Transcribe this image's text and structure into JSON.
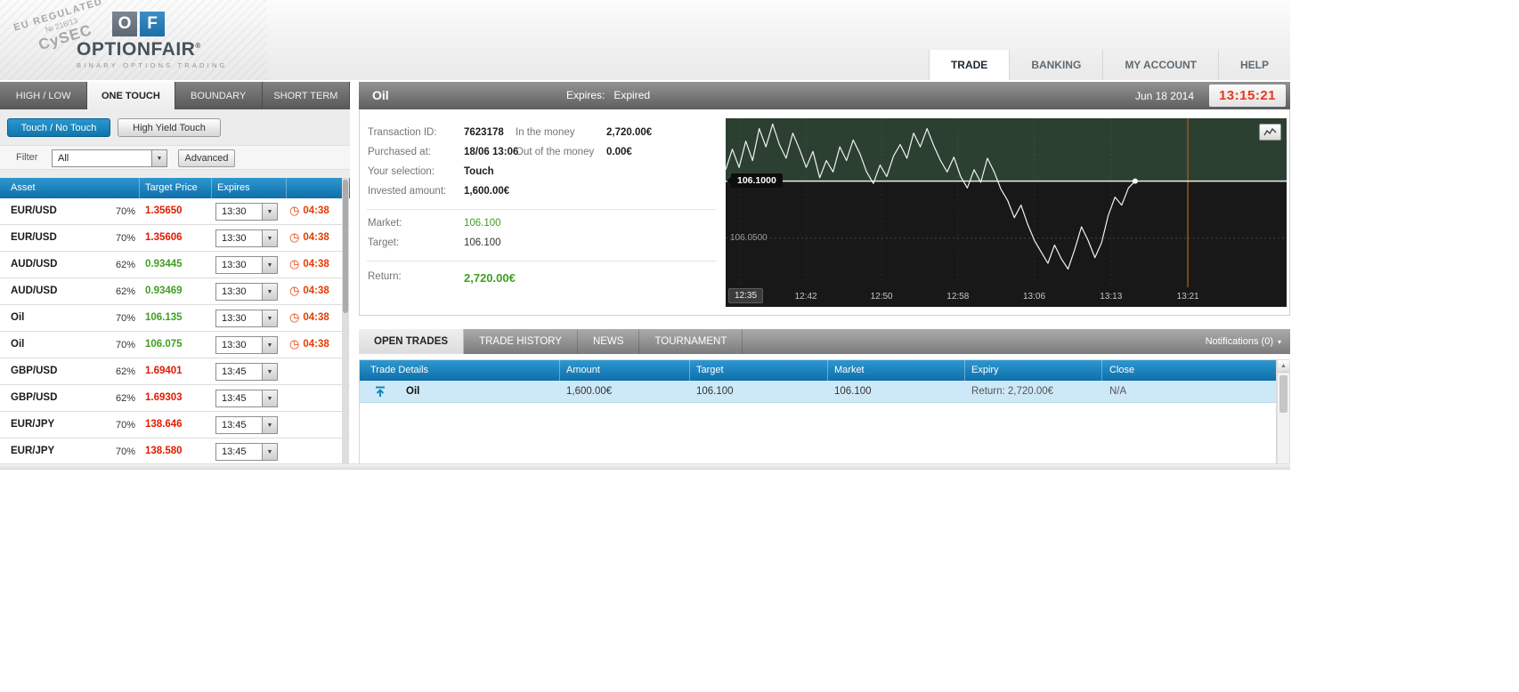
{
  "header": {
    "stamp": {
      "line1": "EU REGULATED",
      "line2": "№ 216/13",
      "line3": "CySEC"
    },
    "logo": {
      "icon_o": "O",
      "icon_f": "F",
      "name": "OPTIONFAIR",
      "reg": "®",
      "tagline": "BINARY OPTIONS TRADING"
    },
    "nav": [
      {
        "label": "TRADE",
        "active": true
      },
      {
        "label": "BANKING",
        "active": false
      },
      {
        "label": "MY ACCOUNT",
        "active": false
      },
      {
        "label": "HELP",
        "active": false
      }
    ]
  },
  "instrument_tabs": [
    {
      "label": "HIGH / LOW",
      "active": false
    },
    {
      "label": "ONE TOUCH",
      "active": true
    },
    {
      "label": "BOUNDARY",
      "active": false
    },
    {
      "label": "SHORT TERM",
      "active": false
    }
  ],
  "left_panel": {
    "touch_button": "Touch / No Touch",
    "high_yield_button": "High Yield Touch",
    "filter_label": "Filter",
    "filter_value": "All",
    "advanced_button": "Advanced",
    "table_headers": [
      "Asset",
      "Target Price",
      "Expires"
    ],
    "rows": [
      {
        "asset": "EUR/USD",
        "payout": "70%",
        "price": "1.35650",
        "trend": "red",
        "expiry": "13:30",
        "countdown": "04:38"
      },
      {
        "asset": "EUR/USD",
        "payout": "70%",
        "price": "1.35606",
        "trend": "red",
        "expiry": "13:30",
        "countdown": "04:38"
      },
      {
        "asset": "AUD/USD",
        "payout": "62%",
        "price": "0.93445",
        "trend": "green",
        "expiry": "13:30",
        "countdown": "04:38"
      },
      {
        "asset": "AUD/USD",
        "payout": "62%",
        "price": "0.93469",
        "trend": "green",
        "expiry": "13:30",
        "countdown": "04:38"
      },
      {
        "asset": "Oil",
        "payout": "70%",
        "price": "106.135",
        "trend": "green",
        "expiry": "13:30",
        "countdown": "04:38"
      },
      {
        "asset": "Oil",
        "payout": "70%",
        "price": "106.075",
        "trend": "green",
        "expiry": "13:30",
        "countdown": "04:38"
      },
      {
        "asset": "GBP/USD",
        "payout": "62%",
        "price": "1.69401",
        "trend": "red",
        "expiry": "13:45",
        "countdown": ""
      },
      {
        "asset": "GBP/USD",
        "payout": "62%",
        "price": "1.69303",
        "trend": "red",
        "expiry": "13:45",
        "countdown": ""
      },
      {
        "asset": "EUR/JPY",
        "payout": "70%",
        "price": "138.646",
        "trend": "red",
        "expiry": "13:45",
        "countdown": ""
      },
      {
        "asset": "EUR/JPY",
        "payout": "70%",
        "price": "138.580",
        "trend": "red",
        "expiry": "13:45",
        "countdown": ""
      }
    ]
  },
  "trade_panel": {
    "title": "Oil",
    "expires_label": "Expires:",
    "expires_value": "Expired",
    "date": "Jun 18 2014",
    "time": "13:15:21",
    "transaction_id_label": "Transaction ID:",
    "transaction_id": "7623178",
    "purchased_label": "Purchased at:",
    "purchased": "18/06 13:06",
    "selection_label": "Your selection:",
    "selection": "Touch",
    "invested_label": "Invested amount:",
    "invested": "1,600.00€",
    "in_money_label": "In the money",
    "in_money": "2,720.00€",
    "out_money_label": "Out of the money",
    "out_money": "0.00€",
    "market_label": "Market:",
    "market": "106.100",
    "target_label": "Target:",
    "target": "106.100",
    "return_label": "Return:",
    "return_value": "2,720.00€"
  },
  "chart_data": {
    "type": "line",
    "title": "Oil intraday price",
    "x_ticks": [
      "12:35",
      "12:42",
      "12:50",
      "12:58",
      "13:06",
      "13:13",
      "13:21"
    ],
    "x_tick_fractions": [
      0.025,
      0.143,
      0.278,
      0.414,
      0.55,
      0.687,
      0.824
    ],
    "price_min": 106.007,
    "price_max": 106.155,
    "target_line": 106.1,
    "target_label": "106.1000",
    "grid_line": 106.05,
    "grid_label": "106.0500",
    "expiry_marker_fraction": 0.824,
    "series_end_fraction": 0.73,
    "prices": [
      106.11,
      106.128,
      106.112,
      106.135,
      106.118,
      106.146,
      106.13,
      106.15,
      106.132,
      106.12,
      106.142,
      106.128,
      106.112,
      106.126,
      106.103,
      106.118,
      106.108,
      106.13,
      106.118,
      106.136,
      106.124,
      106.108,
      106.098,
      106.114,
      106.104,
      106.122,
      106.132,
      106.12,
      106.142,
      106.13,
      106.146,
      106.131,
      106.118,
      106.108,
      106.121,
      106.104,
      106.094,
      106.11,
      106.099,
      106.12,
      106.108,
      106.093,
      106.083,
      106.068,
      106.079,
      106.062,
      106.048,
      106.038,
      106.028,
      106.044,
      106.032,
      106.023,
      106.04,
      106.06,
      106.048,
      106.033,
      106.046,
      106.07,
      106.086,
      106.079,
      106.094,
      106.1
    ]
  },
  "bottom_panel": {
    "tabs": [
      {
        "label": "OPEN TRADES",
        "active": true
      },
      {
        "label": "TRADE HISTORY",
        "active": false
      },
      {
        "label": "NEWS",
        "active": false
      },
      {
        "label": "TOURNAMENT",
        "active": false
      }
    ],
    "notifications": "Notifications (0)",
    "table_headers": [
      "Trade Details",
      "Amount",
      "Target",
      "Market",
      "Expiry",
      "Close"
    ],
    "trades": [
      {
        "asset": "Oil",
        "amount": "1,600.00€",
        "target": "106.100",
        "market": "106.100",
        "expiry": "Return: 2,720.00€",
        "close": "N/A"
      }
    ]
  }
}
